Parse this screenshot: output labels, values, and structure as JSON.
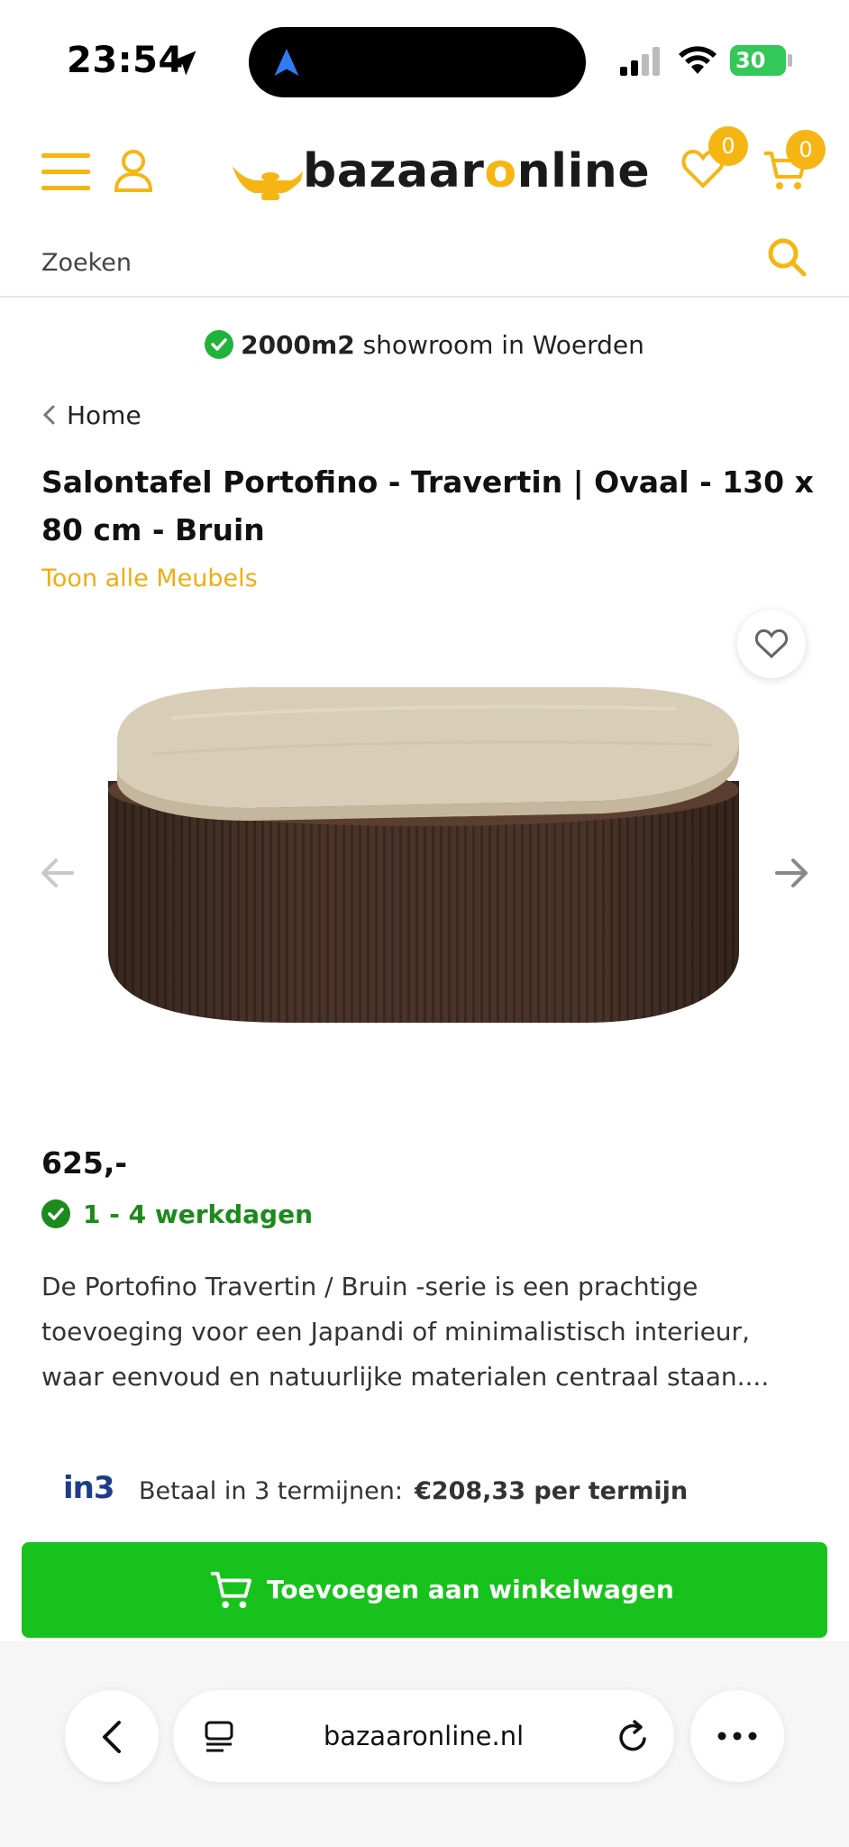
{
  "status_bar": {
    "time": "23:54",
    "battery": "30"
  },
  "header": {
    "logo_text_a": "bazaar",
    "logo_text_o": "o",
    "logo_text_b": "nline",
    "wishlist_count": "0",
    "cart_count": "0"
  },
  "search": {
    "placeholder": "Zoeken"
  },
  "showroom": {
    "bold": "2000m2",
    "rest": " showroom in Woerden"
  },
  "breadcrumb": {
    "label": "Home"
  },
  "product": {
    "title": "Salontafel Portofino - Travertin | Ovaal - 130 x 80 cm - Bruin",
    "category_link": "Toon alle Meubels",
    "price": "625,-",
    "delivery": "1 - 4 werkdagen",
    "description": "De Portofino Travertin / Bruin -serie is een prachtige toevoeging voor een Japandi of minimalistisch interieur, waar eenvoud en natuurlijke materialen centraal staan...."
  },
  "installments": {
    "brand": "in3",
    "label": "Betaal in 3 termijnen:",
    "amount": "€208,33 per termijn"
  },
  "cart_button": {
    "label": "Toevoegen aan winkelwagen"
  },
  "browser": {
    "url": "bazaaronline.nl"
  },
  "colors": {
    "accent": "#f5b614",
    "green": "#18c21c",
    "delivery_green": "#1c8a1c",
    "tabletop": "#d8cdb6",
    "table_body": "#4a3429"
  }
}
